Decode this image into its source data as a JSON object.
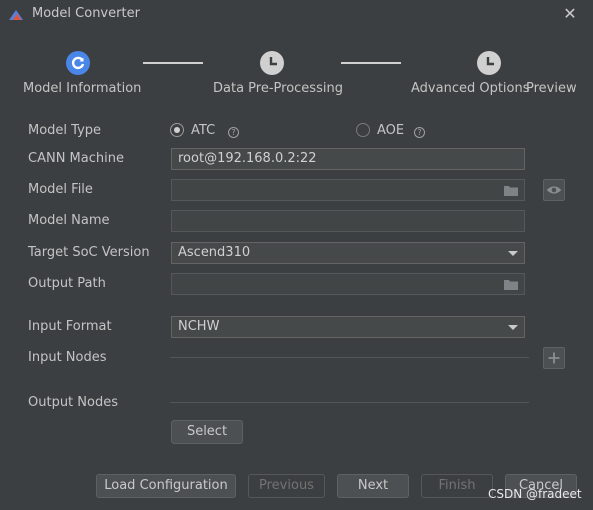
{
  "window": {
    "title": "Model Converter"
  },
  "steps": [
    {
      "label": "Model Information",
      "state": "active"
    },
    {
      "label": "Data Pre-Processing",
      "state": "pending"
    },
    {
      "label": "Advanced Options",
      "state": "pending"
    },
    {
      "label": "Preview",
      "state": "pending"
    }
  ],
  "form": {
    "model_type": {
      "label": "Model Type",
      "options": [
        "ATC",
        "AOE"
      ],
      "selected": "ATC"
    },
    "cann_machine": {
      "label": "CANN Machine",
      "value": "root@192.168.0.2:22"
    },
    "model_file": {
      "label": "Model File",
      "value": ""
    },
    "model_name": {
      "label": "Model Name",
      "value": ""
    },
    "target_soc": {
      "label": "Target SoC Version",
      "value": "Ascend310"
    },
    "output_path": {
      "label": "Output Path",
      "value": ""
    },
    "input_format": {
      "label": "Input Format",
      "value": "NCHW"
    },
    "input_nodes": {
      "label": "Input Nodes"
    },
    "output_nodes": {
      "label": "Output Nodes"
    },
    "select_label": "Select"
  },
  "footer": {
    "load_configuration": "Load Configuration",
    "previous": "Previous",
    "next": "Next",
    "finish": "Finish",
    "cancel": "Cancel"
  },
  "watermark": "CSDN @fradeet",
  "colors": {
    "active_step": "#4a86e8",
    "pending_step": "#d0d0d0",
    "background": "#3c3f41"
  }
}
